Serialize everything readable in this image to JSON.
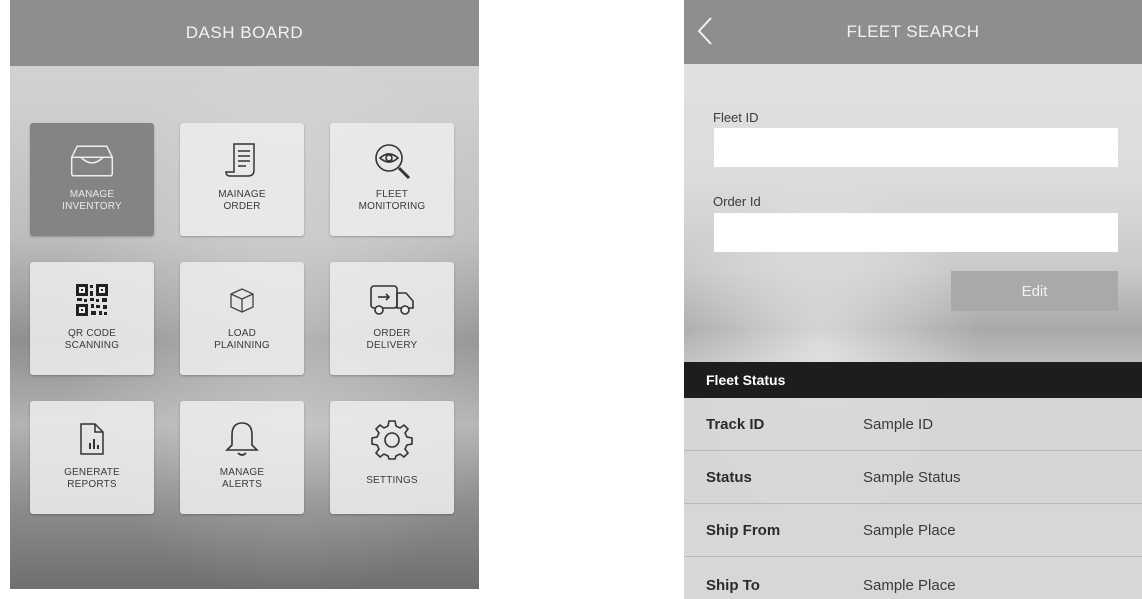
{
  "dashboard": {
    "title": "DASH BOARD",
    "tiles": [
      {
        "label": "MANAGE\nINVENTORY",
        "icon": "inbox-tray-icon",
        "active": true
      },
      {
        "label": "MAINAGE\nORDER",
        "icon": "order-scroll-icon",
        "active": false
      },
      {
        "label": "FLEET\nMONITORING",
        "icon": "magnifier-eye-icon",
        "active": false
      },
      {
        "label": "QR CODE\nSCANNING",
        "icon": "qr-code-icon",
        "active": false
      },
      {
        "label": "LOAD\nPLAINNING",
        "icon": "box-icon",
        "active": false
      },
      {
        "label": "ORDER\nDELIVERY",
        "icon": "delivery-truck-icon",
        "active": false
      },
      {
        "label": "GENERATE\nREPORTS",
        "icon": "report-document-icon",
        "active": false
      },
      {
        "label": "MANAGE\nALERTS",
        "icon": "bell-icon",
        "active": false
      },
      {
        "label": "SETTINGS",
        "icon": "gear-icon",
        "active": false
      }
    ]
  },
  "fleet_search": {
    "title": "FLEET SEARCH",
    "back_icon": "chevron-left-icon",
    "fleet_id_label": "Fleet ID",
    "fleet_id_value": "",
    "order_id_label": "Order Id",
    "order_id_value": "",
    "edit_label": "Edit",
    "status_title": "Fleet Status",
    "rows": [
      {
        "key": "Track ID",
        "value": "Sample ID"
      },
      {
        "key": "Status",
        "value": "Sample Status"
      },
      {
        "key": "Ship From",
        "value": "Sample Place"
      },
      {
        "key": "Ship To",
        "value": "Sample Place"
      }
    ]
  },
  "colors": {
    "header": "#8e8e8e",
    "active_tile": "#848484",
    "tile": "#ececec",
    "status_bar": "#1d1d1d",
    "edit_button": "#a9a9a9"
  }
}
